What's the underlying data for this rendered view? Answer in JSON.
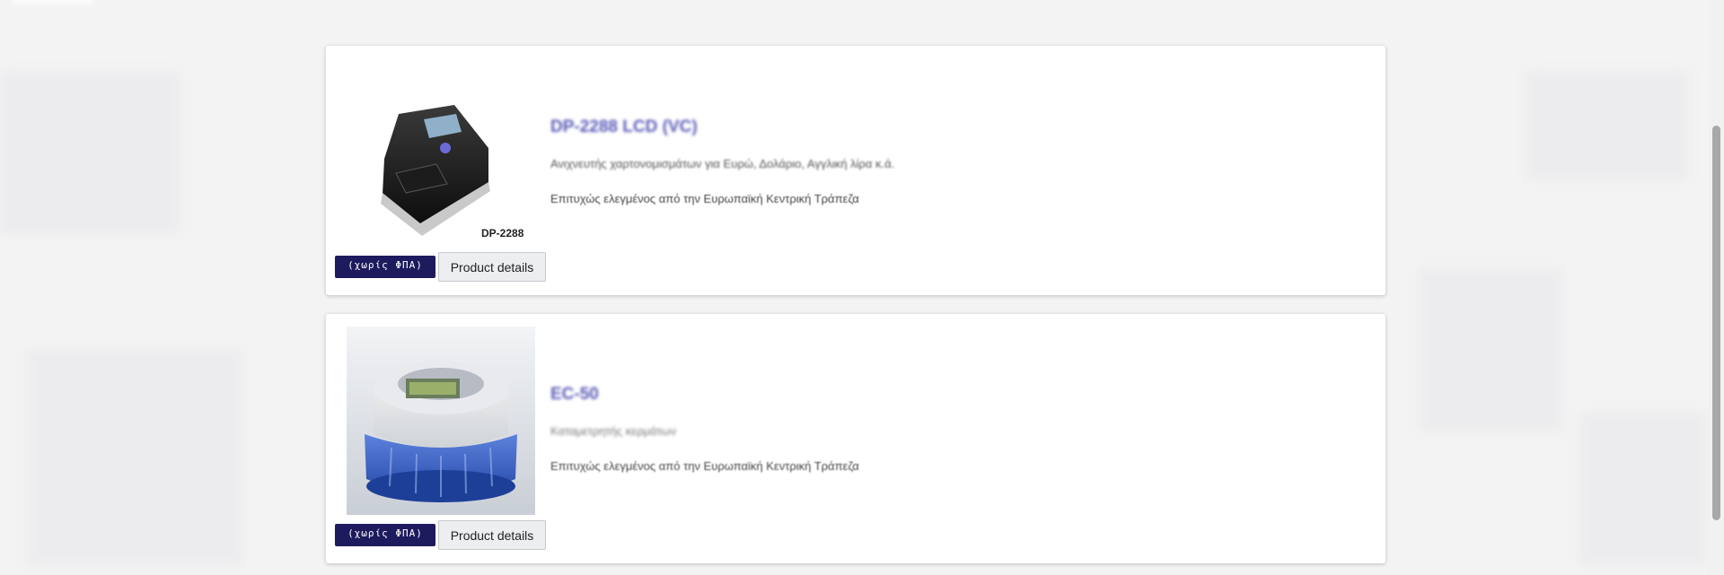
{
  "products": [
    {
      "title": "DP-2288 LCD (VC)",
      "description": "Ανιχνευτής χαρτονομισμάτων για Ευρώ, Δολάριο, Αγγλική λίρα κ.ά.",
      "note": "Επιτυχώς ελεγμένος από την Ευρωπαϊκή Κεντρική Τράπεζα",
      "image_caption": "DP-2288",
      "vat_label": "(χωρίς ΦΠΑ)",
      "details_label": "Product details"
    },
    {
      "title": "EC-50",
      "description": "Καταμετρητής κερμάτων",
      "note": "Επιτυχώς ελεγμένος από την Ευρωπαϊκή Κεντρική Τράπεζα",
      "vat_label": "(χωρίς ΦΠΑ)",
      "details_label": "Product details"
    }
  ],
  "colors": {
    "title": "#5a5ab8",
    "vat_badge": "#1e1a5e",
    "button_bg": "#eceef0"
  },
  "icons": [
    "banknote-detector-image",
    "coin-counter-image"
  ]
}
